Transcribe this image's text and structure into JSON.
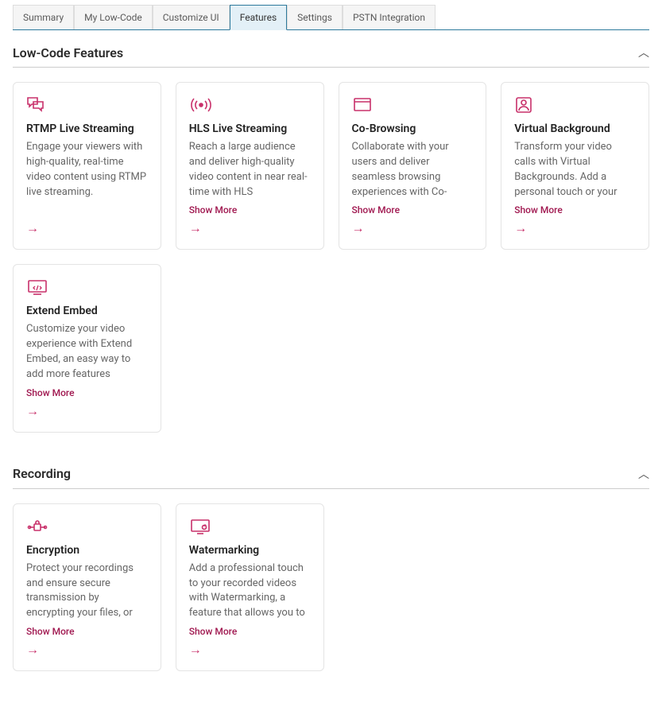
{
  "tabs": [
    {
      "label": "Summary",
      "active": false
    },
    {
      "label": "My Low-Code",
      "active": false
    },
    {
      "label": "Customize UI",
      "active": false
    },
    {
      "label": "Features",
      "active": true
    },
    {
      "label": "Settings",
      "active": false
    },
    {
      "label": "PSTN Integration",
      "active": false
    }
  ],
  "show_more_label": "Show More",
  "sections": [
    {
      "title": "Low-Code Features",
      "cards": [
        {
          "icon": "chat-icon",
          "title": "RTMP Live Streaming",
          "desc": "Engage your viewers with high-quality, real-time video content using RTMP live streaming.",
          "show_more": false
        },
        {
          "icon": "broadcast-icon",
          "title": "HLS Live Streaming",
          "desc": "Reach a large audience and deliver high-quality video content in near real-time with HLS",
          "show_more": true
        },
        {
          "icon": "window-icon",
          "title": "Co-Browsing",
          "desc": "Collaborate with your users and deliver seamless browsing experiences with Co-",
          "show_more": true
        },
        {
          "icon": "person-icon",
          "title": "Virtual Background",
          "desc": "Transform your video calls with Virtual Backgrounds. Add a personal touch or your",
          "show_more": true
        },
        {
          "icon": "embed-icon",
          "title": "Extend Embed",
          "desc": "Customize your video experience with Extend Embed, an easy way to add more features",
          "show_more": true
        }
      ]
    },
    {
      "title": "Recording",
      "cards": [
        {
          "icon": "encryption-icon",
          "title": "Encryption",
          "desc": "Protect your recordings and ensure secure transmission by encrypting your files, or",
          "show_more": true
        },
        {
          "icon": "watermark-icon",
          "title": "Watermarking",
          "desc": "Add a professional touch to your recorded videos with Watermarking, a feature that allows you to",
          "show_more": true
        }
      ]
    }
  ]
}
